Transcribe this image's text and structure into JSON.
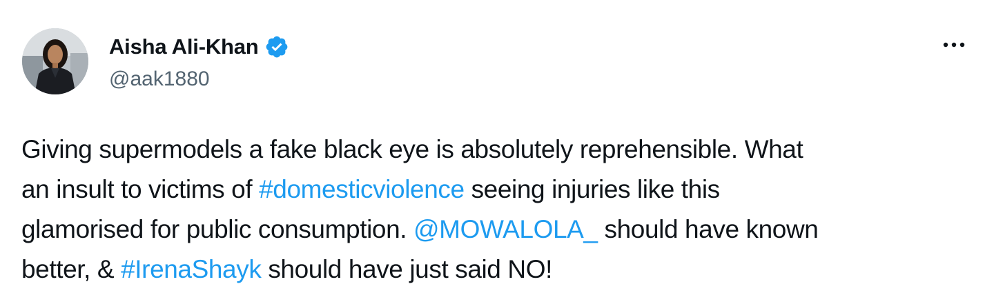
{
  "author": {
    "display_name": "Aisha Ali-Khan",
    "handle": "@aak1880",
    "verified": true,
    "avatar_icon": "profile-photo"
  },
  "menu": {
    "icon": "more-horizontal-icon"
  },
  "colors": {
    "link": "#1d9bf0",
    "verified_badge": "#1d9bf0",
    "text": "#0f1419",
    "secondary_text": "#536471"
  },
  "tweet": {
    "line1": {
      "text": "Giving supermodels a fake black eye is absolutely reprehensible. What"
    },
    "line2": {
      "before": "an insult to victims of ",
      "hashtag": "#domesticviolence",
      "after": " seeing injuries like this"
    },
    "line3": {
      "before": "glamorised for public consumption. ",
      "mention": "@MOWALOLA_",
      "after": " should have known"
    },
    "line4": {
      "before": "better, & ",
      "hashtag": "#IrenaShayk",
      "after": " should have just said NO!"
    }
  }
}
